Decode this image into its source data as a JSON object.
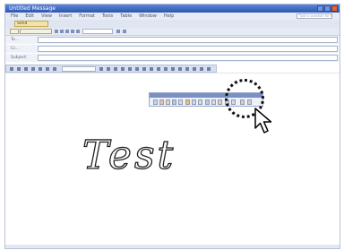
{
  "colors": {
    "titlebar": "#2c56b3",
    "menubar": "#e7ebf3",
    "accent_button": "#f3e4a4",
    "handwriting_ink": "#222222"
  },
  "window": {
    "title": "Untitled Message"
  },
  "menu": [
    "File",
    "Edit",
    "View",
    "Insert",
    "Format",
    "Tools",
    "Table",
    "Window",
    "Help"
  ],
  "help_box": {
    "placeholder": "Type a question for help"
  },
  "toolbar": {
    "send_label": "Send",
    "send_icon": "envelope-icon"
  },
  "fields": [
    {
      "label": "To..."
    },
    {
      "label": "Cc..."
    },
    {
      "label": "Subject:"
    }
  ],
  "body": {
    "handwriting_text": "Test"
  },
  "floating_toolbar": {
    "highlighted_icon": "ink-eraser-icon"
  },
  "cursor": {
    "icon": "arrow-cursor-icon"
  }
}
